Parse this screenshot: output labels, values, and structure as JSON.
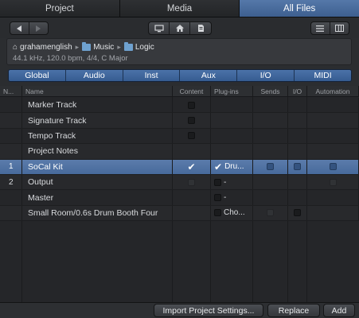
{
  "top_tabs": [
    {
      "label": "Project"
    },
    {
      "label": "Media"
    },
    {
      "label": "All Files"
    }
  ],
  "path": {
    "items": [
      "grahamenglish",
      "Music",
      "Logic"
    ],
    "info": "44.1 kHz, 120.0 bpm, 4/4, C Major"
  },
  "filters": [
    "Global",
    "Audio",
    "Inst",
    "Aux",
    "I/O",
    "MIDI"
  ],
  "table": {
    "headers": [
      "N...",
      "Name",
      "Content",
      "Plug-ins",
      "Sends",
      "I/O",
      "Automation"
    ],
    "rows": [
      {
        "num": "",
        "name": "Marker Track",
        "plug": ""
      },
      {
        "num": "",
        "name": "Signature Track",
        "plug": ""
      },
      {
        "num": "",
        "name": "Tempo Track",
        "plug": ""
      },
      {
        "num": "",
        "name": "Project Notes",
        "plug": ""
      },
      {
        "num": "1",
        "name": "SoCal Kit",
        "plug": "Dru..."
      },
      {
        "num": "2",
        "name": "Output",
        "plug": "-"
      },
      {
        "num": "",
        "name": "Master",
        "plug": "-"
      },
      {
        "num": "",
        "name": "Small Room/0.6s Drum Booth Four",
        "plug": "Cho..."
      }
    ]
  },
  "buttons": {
    "import": "Import Project Settings...",
    "replace": "Replace",
    "add": "Add"
  },
  "colors": {
    "accent": "#4b72a8",
    "selected_row": "#5476a6",
    "background": "#2b2d30"
  }
}
